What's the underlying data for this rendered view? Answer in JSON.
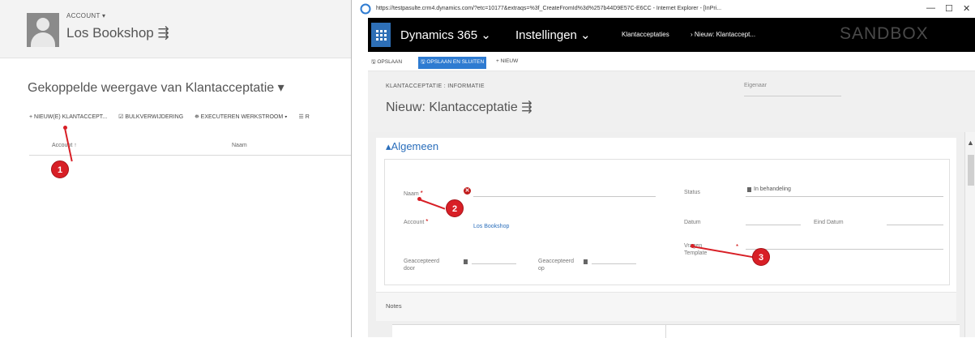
{
  "background_window": {
    "account_label": "ACCOUNT ▾",
    "account_name": "Los Bookshop ⇶",
    "view_title": "Gekoppelde weergave van Klantacceptatie ▾",
    "toolbar": [
      "+ NIEUW(E) KLANTACCEPT...",
      "☑ BULKVERWIJDERING",
      "⛯ EXECUTEREN WERKSTROOM ▾",
      "☰ R"
    ],
    "columns": [
      "Account ↑",
      "Naam"
    ]
  },
  "ie_window": {
    "url": "https://testpasulte.crm4.dynamics.com/?etc=10177&extraqs=%3f_CreateFromId%3d%257b44D9E57C-E6CC - Internet Explorer - [InPri...",
    "controls": [
      "—",
      "☐",
      "✕"
    ],
    "nav": {
      "brand": "Dynamics 365 ⌄",
      "module": "Instellingen ⌄",
      "crumb1": "Klantacceptaties",
      "crumb2": "›  Nieuw: Klantaccept...",
      "environment": "SANDBOX"
    },
    "commands": [
      "🖫 OPSLAAN",
      "🖫 OPSLAAN EN SLUITEN",
      "+ NIEUW"
    ],
    "form": {
      "entity_label": "KLANTACCEPTATIE : INFORMATIE",
      "record_name": "Nieuw: Klantacceptatie ⇶",
      "owner_label": "Eigenaar",
      "section_title": "▴Algemeen",
      "fields": {
        "naam_label": "Naam",
        "account_label": "Account",
        "account_value": "Los Bookshop",
        "geaccepteerd_door_label": "Geaccepteerd door",
        "geaccepteerd_op_label": "Geaccepteerd op",
        "status_label": "Status",
        "status_value": "In behandeling",
        "datum_label": "Datum",
        "eind_datum_label": "Eind Datum",
        "vragen_template_label": "Vragen Template"
      },
      "notes_title": "Notes"
    }
  },
  "markers": [
    "1",
    "2",
    "3"
  ],
  "colors": {
    "nav_bg": "#000000",
    "accent_blue": "#2a6ebb",
    "marker_red": "#d81f26"
  }
}
